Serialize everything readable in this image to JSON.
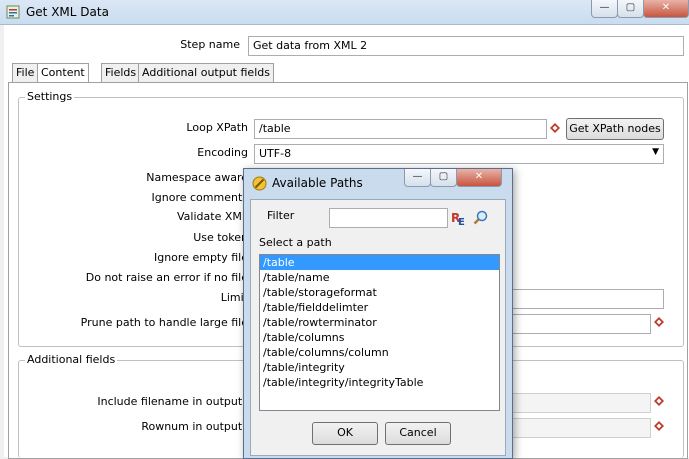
{
  "window": {
    "title": "Get XML Data",
    "min": "—",
    "max": "▢",
    "close": "✕"
  },
  "step": {
    "label": "Step name",
    "value": "Get data from XML 2"
  },
  "tabs": [
    "File",
    "Content",
    "Fields",
    "Additional output fields"
  ],
  "settings": {
    "title": "Settings",
    "loop_xpath_label": "Loop XPath",
    "loop_xpath_value": "/table",
    "get_nodes_button": "Get XPath nodes",
    "encoding_label": "Encoding",
    "encoding_value": "UTF-8",
    "namespace_label": "Namespace aware",
    "ignore_comments_label": "Ignore comments",
    "validate_label": "Validate XML",
    "use_token_label": "Use token",
    "ignore_empty_label": "Ignore empty file",
    "no_error_label": "Do not raise an error if no file",
    "limit_label": "Limit",
    "prune_label": "Prune path to handle large file"
  },
  "additional": {
    "title": "Additional fields",
    "include_filename_label": "Include filename in output?",
    "rownum_label": "Rownum in output?"
  },
  "dialog": {
    "title": "Available Paths",
    "filter_label": "Filter",
    "filter_value": "",
    "select_label": "Select a path",
    "paths": [
      "/table",
      "/table/name",
      "/table/storageformat",
      "/table/fielddelimter",
      "/table/rowterminator",
      "/table/columns",
      "/table/columns/column",
      "/table/integrity",
      "/table/integrity/integrityTable"
    ],
    "ok": "OK",
    "cancel": "Cancel"
  }
}
